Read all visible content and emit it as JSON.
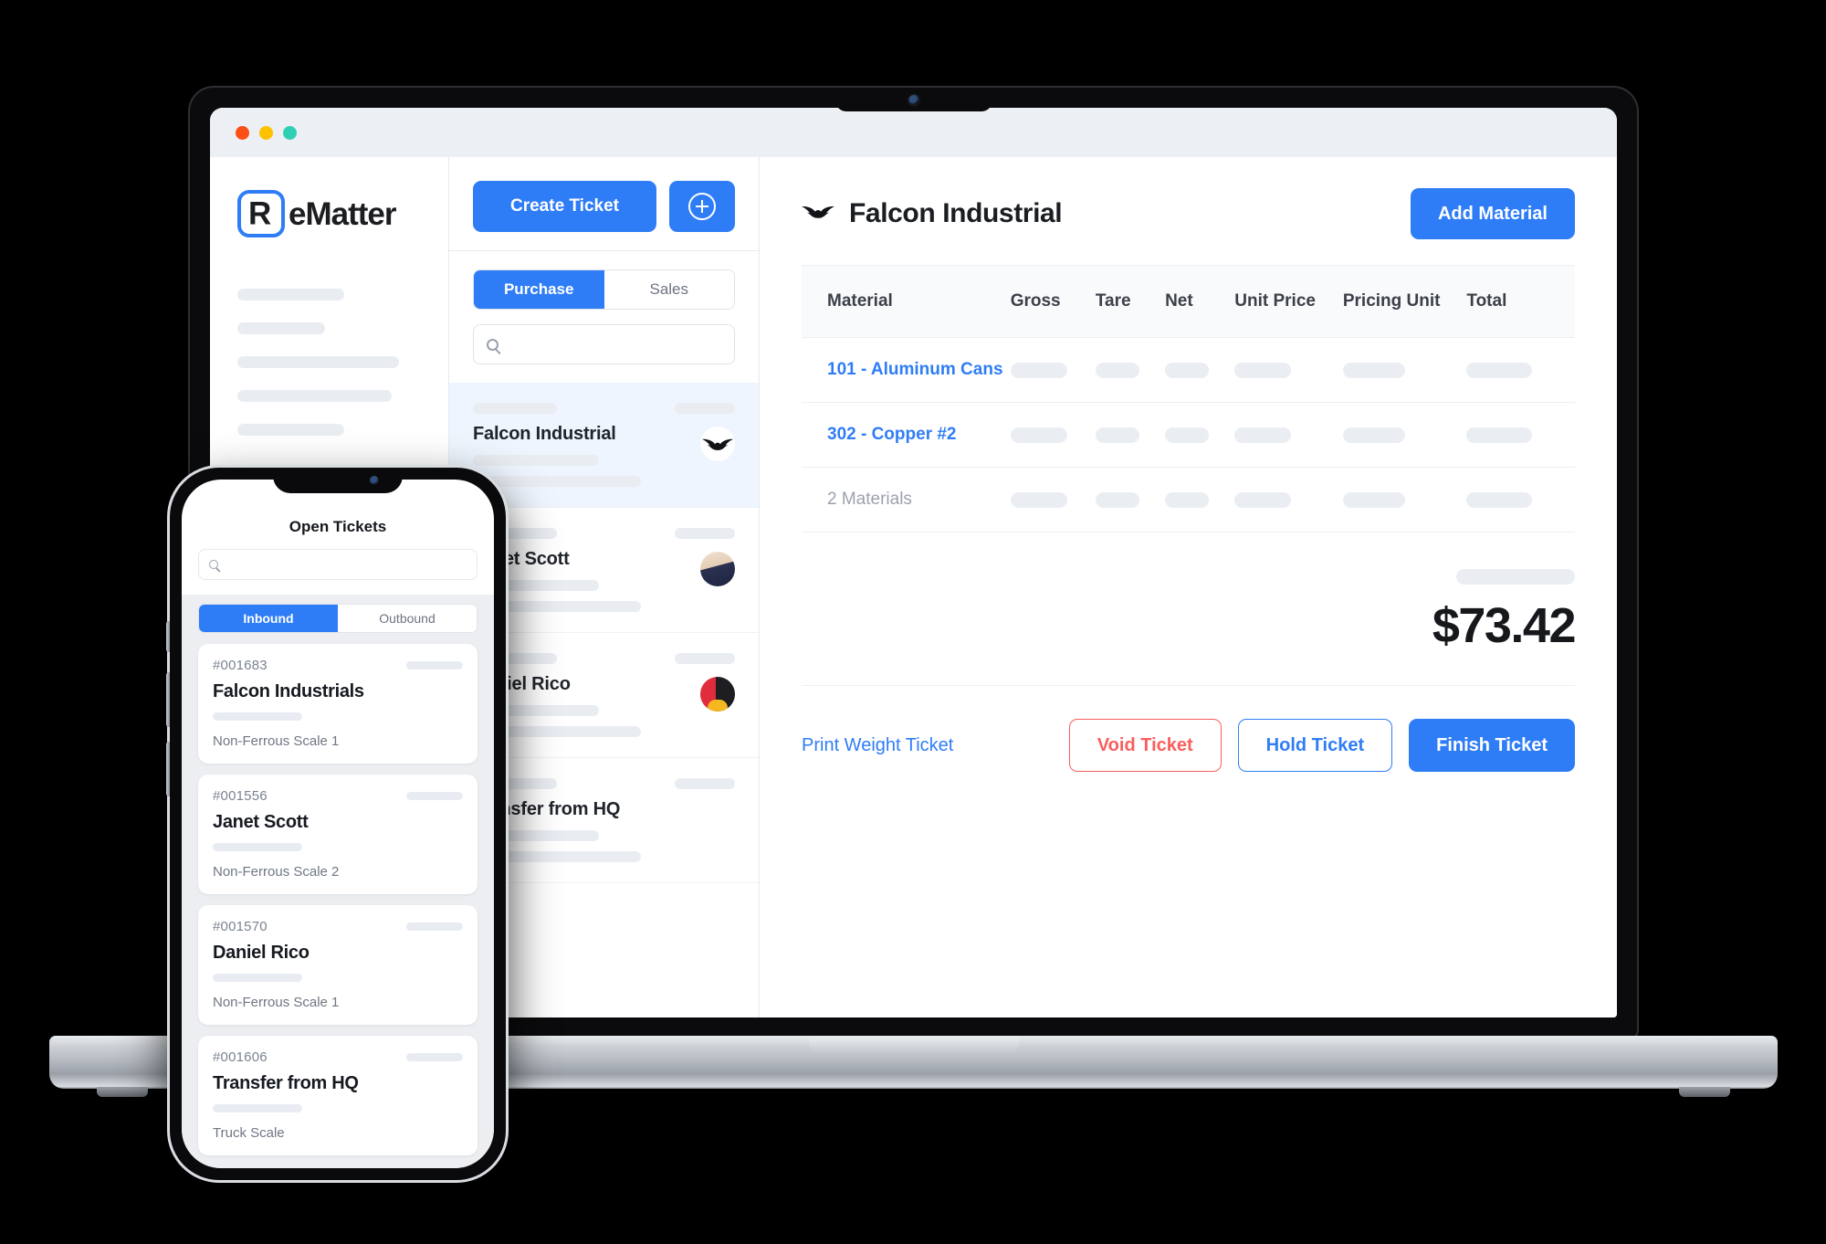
{
  "brand": {
    "name_prefix": "R",
    "name_rest": "eMatter",
    "accent": "#2f7df6",
    "danger": "#fb5d5d"
  },
  "window_chrome": {
    "dots": [
      "close",
      "minimize",
      "maximize"
    ]
  },
  "sidebar": {
    "skeleton_widths": [
      "58%",
      "48%",
      "88%",
      "84%",
      "58%"
    ]
  },
  "ticket_list": {
    "create_label": "Create Ticket",
    "add_icon": "plus-circle-icon",
    "tabs": [
      {
        "label": "Purchase",
        "active": true
      },
      {
        "label": "Sales",
        "active": false
      }
    ],
    "search": {
      "value": "",
      "placeholder": "",
      "icon": "search-icon"
    },
    "customers": [
      {
        "name": "Falcon Industrial",
        "selected": true,
        "avatar": "falcon-logo"
      },
      {
        "name": "Janet Scott",
        "selected": false,
        "avatar": "photo-janet"
      },
      {
        "name": "Daniel Rico",
        "selected": false,
        "avatar": "photo-daniel"
      },
      {
        "name": "Transfer from HQ",
        "selected": false,
        "avatar": "none"
      }
    ]
  },
  "detail": {
    "title": "Falcon Industrial",
    "title_icon": "falcon-logo-icon",
    "add_material_label": "Add Material",
    "table": {
      "columns": [
        "Material",
        "Gross",
        "Tare",
        "Net",
        "Unit Price",
        "Pricing Unit",
        "Total"
      ],
      "rows": [
        {
          "material": "101 - Aluminum Cans",
          "muted": false
        },
        {
          "material": "302 - Copper #2",
          "muted": false
        },
        {
          "material": "2 Materials",
          "muted": true
        }
      ]
    },
    "total_amount": "$73.42",
    "actions": {
      "print_label": "Print Weight Ticket",
      "void_label": "Void Ticket",
      "hold_label": "Hold Ticket",
      "finish_label": "Finish Ticket"
    }
  },
  "phone": {
    "title": "Open Tickets",
    "search": {
      "value": "",
      "placeholder": "",
      "icon": "search-icon"
    },
    "tabs": [
      {
        "label": "Inbound",
        "active": true
      },
      {
        "label": "Outbound",
        "active": false
      }
    ],
    "tickets": [
      {
        "number": "#001683",
        "name": "Falcon Industrials",
        "scale": "Non-Ferrous Scale 1"
      },
      {
        "number": "#001556",
        "name": "Janet Scott",
        "scale": "Non-Ferrous Scale 2"
      },
      {
        "number": "#001570",
        "name": "Daniel Rico",
        "scale": "Non-Ferrous Scale 1"
      },
      {
        "number": "#001606",
        "name": "Transfer from HQ",
        "scale": "Truck Scale"
      }
    ]
  }
}
